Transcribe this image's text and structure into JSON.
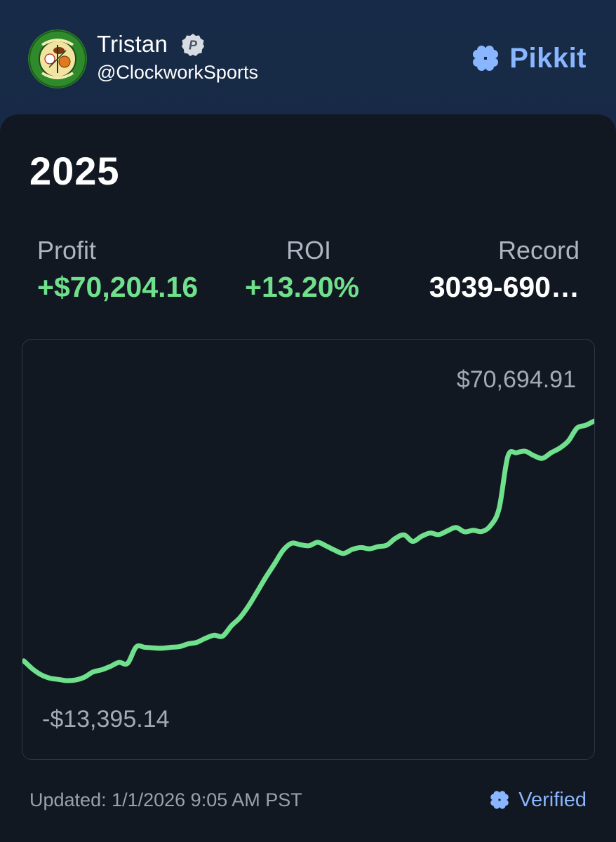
{
  "header": {
    "user_name": "Tristan",
    "user_handle": "@ClockworkSports",
    "verified_badge_letter": "P",
    "avatar_icon": "clockwork-sports-logo",
    "brand_name": "Pikkit",
    "brand_icon": "clover-icon",
    "brand_color": "#8ab6ff"
  },
  "card": {
    "year": "2025",
    "stats": [
      {
        "label": "Profit",
        "value": "+$70,204.16"
      },
      {
        "label": "ROI",
        "value": "+13.20%"
      },
      {
        "label": "Record",
        "value": "3039-690…"
      }
    ],
    "chart_max_label": "$70,694.91",
    "chart_min_label": "-$13,395.14",
    "updated": "Updated: 1/1/2026 9:05 AM PST",
    "verified_label": "Verified",
    "positive_color": "#6fe08c"
  },
  "chart_data": {
    "type": "line",
    "title": "",
    "xlabel": "",
    "ylabel": "",
    "ylim": [
      -13395.14,
      70694.91
    ],
    "series": [
      {
        "values": [
          -7000,
          -9600,
          -11500,
          -12600,
          -13000,
          -13395.14,
          -13200,
          -12300,
          -10600,
          -9900,
          -8800,
          -7500,
          -7800,
          -2500,
          -2600,
          -2800,
          -2900,
          -2600,
          -2400,
          -1500,
          -1000,
          300,
          1300,
          1000,
          4300,
          7000,
          10800,
          15400,
          20100,
          24400,
          28800,
          31100,
          30600,
          30300,
          31400,
          30200,
          28800,
          27800,
          29100,
          29700,
          29300,
          30000,
          30500,
          32700,
          33800,
          31700,
          33300,
          34400,
          33900,
          35100,
          36200,
          34800,
          35300,
          34900,
          36800,
          42500,
          59200,
          60400,
          60900,
          59500,
          58600,
          60400,
          61900,
          64200,
          68400,
          69300,
          70694.91
        ]
      }
    ],
    "grid": false,
    "legend": "none"
  }
}
